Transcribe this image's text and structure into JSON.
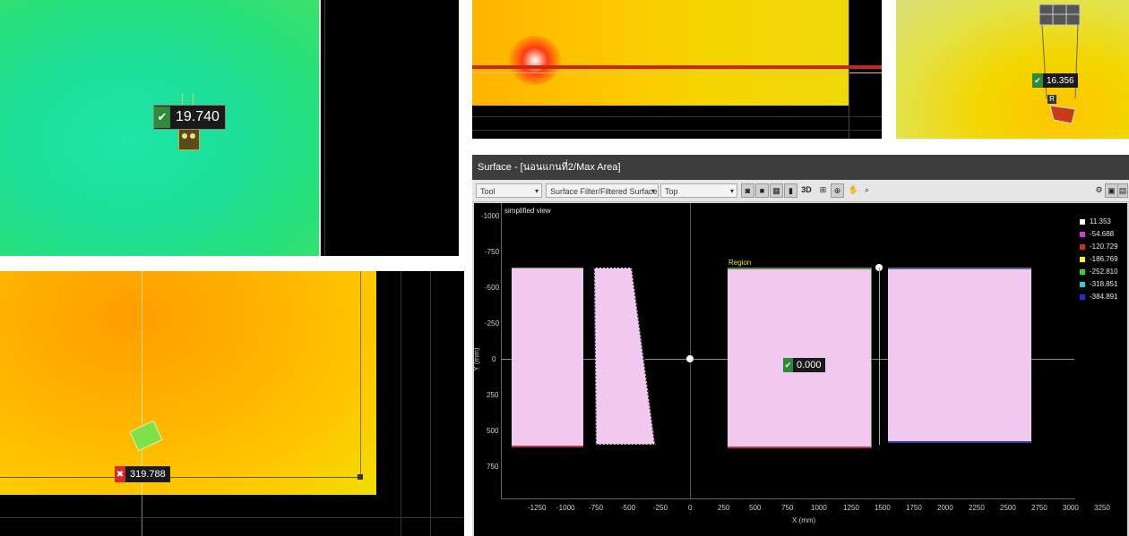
{
  "panel1": {
    "measure": "19.740",
    "status_icon": "check-icon",
    "status_color": "#2e8b3a"
  },
  "panel2": {},
  "panel3": {
    "measure": "16.356",
    "status_icon": "check-icon",
    "status_color": "#2e8b3a",
    "tag": "R"
  },
  "panel4": {
    "measure": "319.788",
    "status_icon": "cross-icon",
    "status_color": "#d42a2a"
  },
  "surface_window": {
    "title": "Surface - [นอนแกนที่2/Max Area]",
    "toolbar": {
      "tool_select": "Tool",
      "filter_select": "Surface Filter/Filtered Surface",
      "view_select": "Top",
      "btn_3d": "3D"
    },
    "plot": {
      "view_label": "simplified view",
      "region_label": "Region",
      "measure": "0.000",
      "status_icon": "check-icon",
      "status_color": "#2e8b3a",
      "y_ticks": [
        "-1000",
        "-750",
        "-500",
        "-250",
        "0",
        "250",
        "500",
        "750"
      ],
      "x_ticks": [
        "-1250",
        "-1000",
        "-750",
        "-500",
        "-250",
        "0",
        "250",
        "500",
        "750",
        "1000",
        "1250",
        "1500",
        "1750",
        "2000",
        "2250",
        "2500",
        "2750",
        "3000",
        "3250"
      ],
      "ylabel": "Y (mm)",
      "xlabel": "X (mm)",
      "legend": [
        {
          "value": "11.353",
          "color": "#ffffff"
        },
        {
          "value": "-54.688",
          "color": "#d63ad6"
        },
        {
          "value": "-120.729",
          "color": "#d22a2a"
        },
        {
          "value": "-186.769",
          "color": "#f2f22a"
        },
        {
          "value": "-252.810",
          "color": "#2ed22e"
        },
        {
          "value": "-318.851",
          "color": "#2ad2d2"
        },
        {
          "value": "-384.891",
          "color": "#2a2ad2"
        }
      ]
    }
  }
}
